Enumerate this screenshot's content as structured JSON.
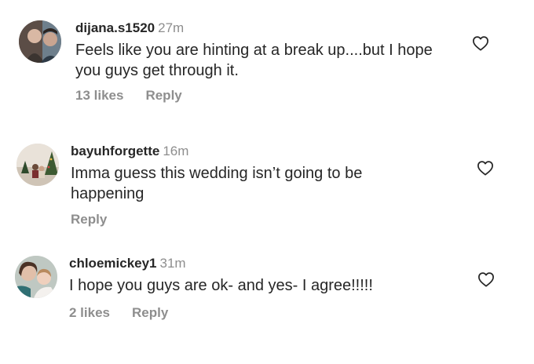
{
  "comments": [
    {
      "username": "dijana.s1520",
      "time": "27m",
      "text": "Feels like you are hinting at a break up....but I hope you guys get through it.",
      "likes": "13 likes",
      "reply": "Reply"
    },
    {
      "username": "bayuhforgette",
      "time": "16m",
      "text": "Imma guess this wedding isn’t going to be happening",
      "likes": "",
      "reply": "Reply"
    },
    {
      "username": "chloemickey1",
      "time": "31m",
      "text": "I hope you guys are ok- and yes- I agree!!!!!",
      "likes": "2 likes",
      "reply": "Reply"
    }
  ],
  "icons": {
    "like": "heart-outline-icon"
  },
  "colors": {
    "text": "#262626",
    "secondary": "#8e8e8e"
  }
}
